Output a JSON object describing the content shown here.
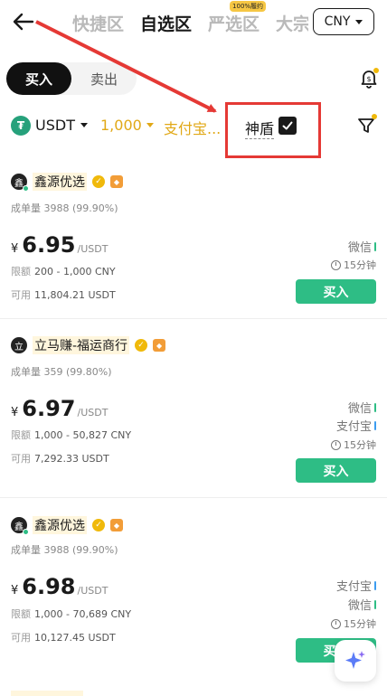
{
  "nav": {
    "tabs": [
      {
        "label": "快捷区"
      },
      {
        "label": "自选区"
      },
      {
        "label": "严选区",
        "badge": "100%履约"
      },
      {
        "label": "大宗"
      }
    ],
    "currency": "CNY"
  },
  "trade_toggle": {
    "buy": "买入",
    "sell": "卖出"
  },
  "filters": {
    "coin": "USDT",
    "amount": "1,000",
    "payment": "支付宝...",
    "shield": "神盾"
  },
  "colors": {
    "accent": "#e1a816",
    "buy": "#2ebd85",
    "annotation": "#e53935"
  },
  "merchants": [
    {
      "avatar": "鑫",
      "name": "鑫源优选",
      "stats": "成单量 3988 (99.90%)",
      "currency_symbol": "¥",
      "price": "6.95",
      "unit": "/USDT",
      "limit_label": "限额",
      "limit": "200 - 1,000 CNY",
      "available_label": "可用",
      "available": "11,804.21 USDT",
      "payments": [
        "微信"
      ],
      "time": "15分钟",
      "buy_label": "买入"
    },
    {
      "avatar": "立",
      "name": "立马赚-福运商行",
      "stats": "成单量 359 (99.80%)",
      "currency_symbol": "¥",
      "price": "6.97",
      "unit": "/USDT",
      "limit_label": "限额",
      "limit": "1,000 - 50,827 CNY",
      "available_label": "可用",
      "available": "7,292.33 USDT",
      "payments": [
        "微信",
        "支付宝"
      ],
      "time": "15分钟",
      "buy_label": "买入"
    },
    {
      "avatar": "鑫",
      "name": "鑫源优选",
      "stats": "成单量 3988 (99.90%)",
      "currency_symbol": "¥",
      "price": "6.98",
      "unit": "/USDT",
      "limit_label": "限额",
      "limit": "1,000 - 70,689 CNY",
      "available_label": "可用",
      "available": "10,127.45 USDT",
      "payments": [
        "支付宝",
        "微信"
      ],
      "time": "15分钟",
      "buy_label": "买入"
    }
  ]
}
